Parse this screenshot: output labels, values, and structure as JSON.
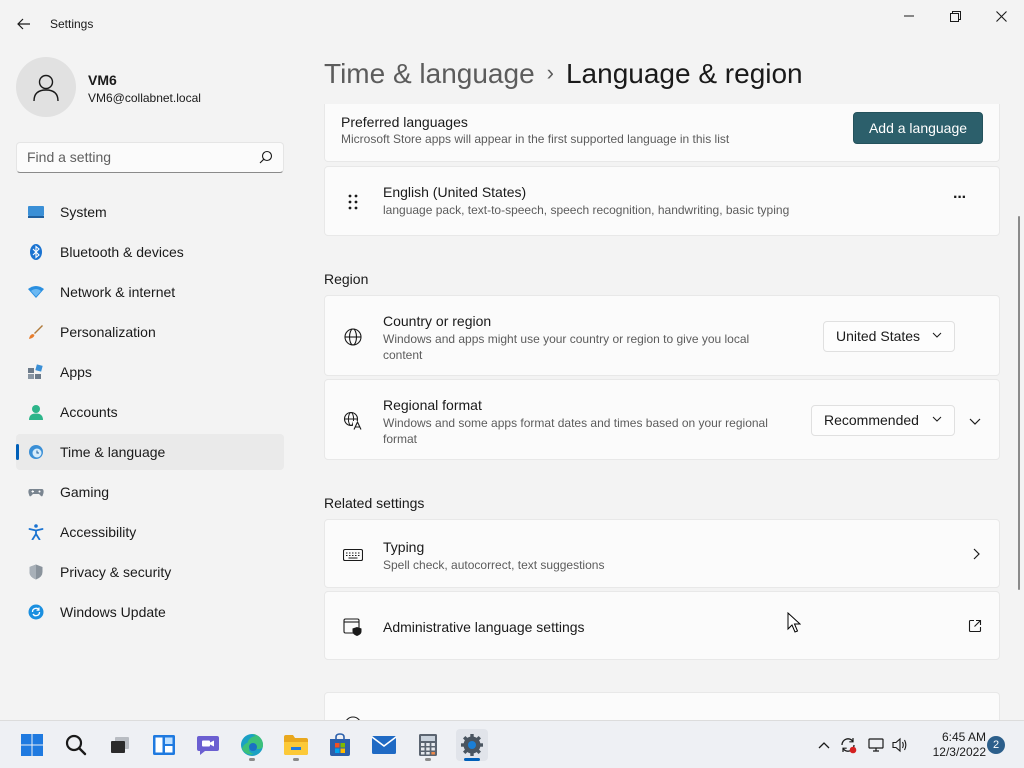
{
  "window": {
    "title": "Settings"
  },
  "profile": {
    "name": "VM6",
    "email": "VM6@collabnet.local"
  },
  "search": {
    "placeholder": "Find a setting"
  },
  "sidebar": {
    "items": [
      {
        "label": "System",
        "icon": "system-icon",
        "active": false
      },
      {
        "label": "Bluetooth & devices",
        "icon": "bluetooth-icon",
        "active": false
      },
      {
        "label": "Network & internet",
        "icon": "network-icon",
        "active": false
      },
      {
        "label": "Personalization",
        "icon": "brush-icon",
        "active": false
      },
      {
        "label": "Apps",
        "icon": "apps-icon",
        "active": false
      },
      {
        "label": "Accounts",
        "icon": "accounts-icon",
        "active": false
      },
      {
        "label": "Time & language",
        "icon": "time-language-icon",
        "active": true
      },
      {
        "label": "Gaming",
        "icon": "gaming-icon",
        "active": false
      },
      {
        "label": "Accessibility",
        "icon": "accessibility-icon",
        "active": false
      },
      {
        "label": "Privacy & security",
        "icon": "shield-icon",
        "active": false
      },
      {
        "label": "Windows Update",
        "icon": "update-icon",
        "active": false
      }
    ]
  },
  "header": {
    "parent": "Time & language",
    "separator": "›",
    "current": "Language & region"
  },
  "preferred": {
    "title": "Preferred languages",
    "desc": "Microsoft Store apps will appear in the first supported language in this list",
    "add_button": "Add a language"
  },
  "language": {
    "name": "English (United States)",
    "features": "language pack, text-to-speech, speech recognition, handwriting, basic typing",
    "more": "···"
  },
  "region": {
    "section_title": "Region",
    "country": {
      "title": "Country or region",
      "desc_line1": "Windows and apps might use your country or region to give you local",
      "desc_line2": "content",
      "value": "United States"
    },
    "format": {
      "title": "Regional format",
      "desc_line1": "Windows and some apps format dates and times based on your regional",
      "desc_line2": "format",
      "value": "Recommended"
    }
  },
  "related": {
    "section_title": "Related settings",
    "typing": {
      "title": "Typing",
      "desc": "Spell check, autocorrect, text suggestions"
    },
    "admin": {
      "title": "Administrative language settings"
    }
  },
  "taskbar": {
    "apps": [
      "start-icon",
      "search-icon",
      "task-view-icon",
      "widgets-icon",
      "chat-icon",
      "edge-icon",
      "file-explorer-icon",
      "store-icon",
      "mail-icon",
      "calculator-icon",
      "settings-icon"
    ],
    "time": "6:45 AM",
    "date": "12/3/2022",
    "notification_count": "2"
  },
  "colors": {
    "accent": "#005fb8",
    "button_accent": "#2c5f6b",
    "background": "#f3f3f3",
    "card": "#fbfbfb"
  }
}
